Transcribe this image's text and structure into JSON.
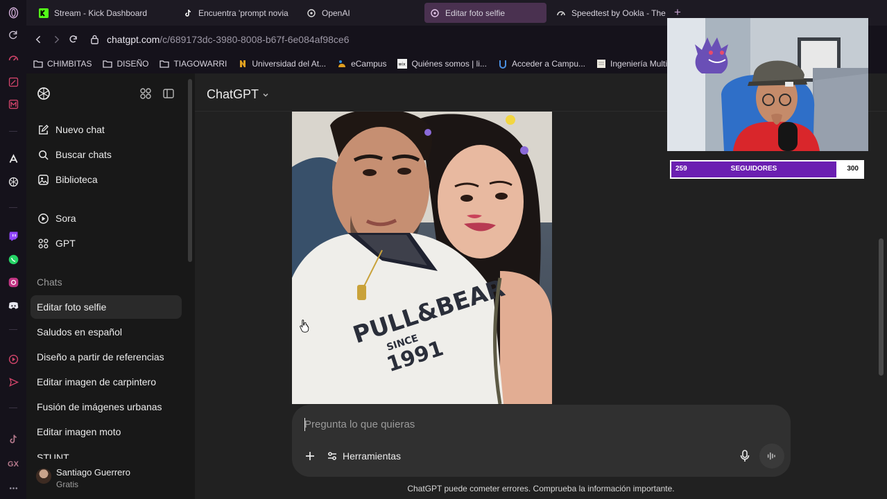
{
  "browser": {
    "tabs": [
      {
        "label": "Stream - Kick Dashboard",
        "icon": "kick-icon"
      },
      {
        "label": "Encuentra 'prompt novia",
        "icon": "tiktok-icon"
      },
      {
        "label": "OpenAI",
        "icon": "openai-icon"
      },
      {
        "label": "Editar foto selfie",
        "icon": "openai-icon",
        "active": true
      },
      {
        "label": "Speedtest by Ookla - The",
        "icon": "speedtest-icon"
      }
    ],
    "url_host": "chatgpt.com",
    "url_path": "/c/689173dc-3980-8008-b67f-6e084af98ce6",
    "bookmarks": [
      {
        "label": "CHIMBITAS",
        "icon": "folder-icon"
      },
      {
        "label": "DISEÑO",
        "icon": "folder-icon"
      },
      {
        "label": "TIAGOWARRI",
        "icon": "folder-icon"
      },
      {
        "label": "Universidad del At...",
        "icon": "university-icon"
      },
      {
        "label": "eCampus",
        "icon": "ecampus-icon"
      },
      {
        "label": "Quiénes somos | li...",
        "icon": "wix-icon"
      },
      {
        "label": "Acceder a Campu...",
        "icon": "campus-icon"
      },
      {
        "label": "Ingeniería Multime",
        "icon": "page-icon"
      }
    ]
  },
  "sidebar": {
    "menu": [
      {
        "label": "Nuevo chat",
        "icon": "new-chat-icon"
      },
      {
        "label": "Buscar chats",
        "icon": "search-icon"
      },
      {
        "label": "Biblioteca",
        "icon": "library-icon"
      },
      {
        "label": "Sora",
        "icon": "sora-icon"
      },
      {
        "label": "GPT",
        "icon": "gpt-grid-icon"
      }
    ],
    "section_label": "Chats",
    "chats": [
      "Editar foto selfie",
      "Saludos en español",
      "Diseño a partir de referencias",
      "Editar imagen de carpintero",
      "Fusión de imágenes urbanas",
      "Editar imagen moto",
      "STUNT"
    ],
    "user": {
      "name": "Santiago Guerrero",
      "plan": "Gratis"
    }
  },
  "main": {
    "title": "ChatGPT",
    "composer_placeholder": "Pregunta lo que quieras",
    "tools_label": "Herramientas",
    "disclaimer": "ChatGPT puede cometer errores. Comprueba la información importante."
  },
  "stream_overlay": {
    "followers_current": "259",
    "followers_label": "SEGUIDORES",
    "followers_goal": "300",
    "progress_fraction": 0.863
  }
}
